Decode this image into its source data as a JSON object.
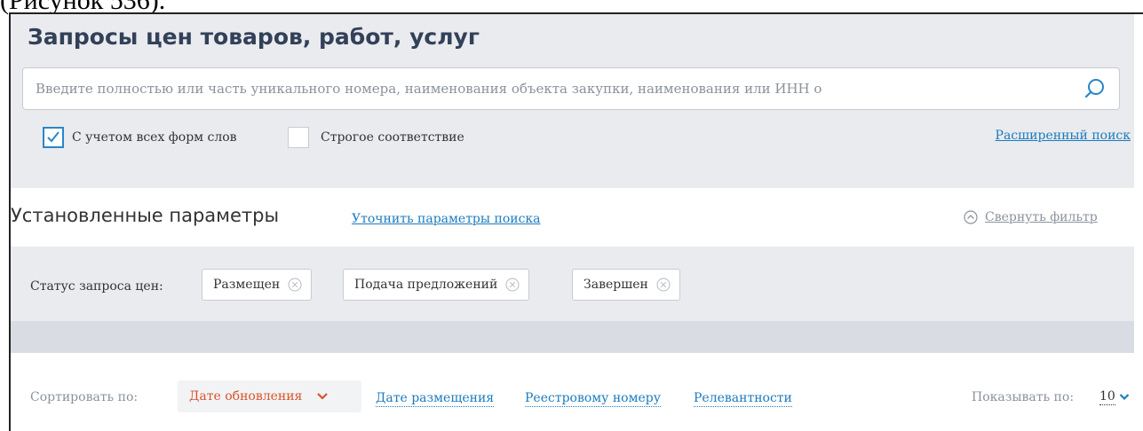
{
  "doc_caption": "(Рисунок 536).",
  "search": {
    "title": "Запросы цен товаров, работ, услуг",
    "placeholder": "Введите полностью или часть уникального номера, наименования объекта закупки, наименования или ИНН о",
    "value": "",
    "all_word_forms_label": "С учетом всех форм слов",
    "all_word_forms_checked": true,
    "strict_label": "Строгое соответствие",
    "strict_checked": false,
    "advanced_link": "Расширенный поиск",
    "icon": "search-icon"
  },
  "params": {
    "title": "Установленные параметры",
    "refine_link": "Уточнить параметры поиска",
    "collapse_label": "Свернуть фильтр",
    "collapse_icon": "chevron-up-circle-icon"
  },
  "filters": {
    "status_label": "Статус запроса цен:",
    "chips": [
      {
        "label": "Размещен"
      },
      {
        "label": "Подача предложений"
      },
      {
        "label": "Завершен"
      }
    ],
    "remove_icon": "close-circle-icon"
  },
  "sort": {
    "label": "Сортировать по:",
    "active": "Дате обновления",
    "options": [
      "Дате размещения",
      "Реестровому номеру",
      "Релевантности"
    ]
  },
  "pagination": {
    "label": "Показывать по:",
    "value": "10"
  },
  "colors": {
    "accent": "#2a86c9",
    "link": "#1c7bbd",
    "active_sort": "#d9532c",
    "panel_bg": "#e9ebee",
    "title": "#334059"
  }
}
